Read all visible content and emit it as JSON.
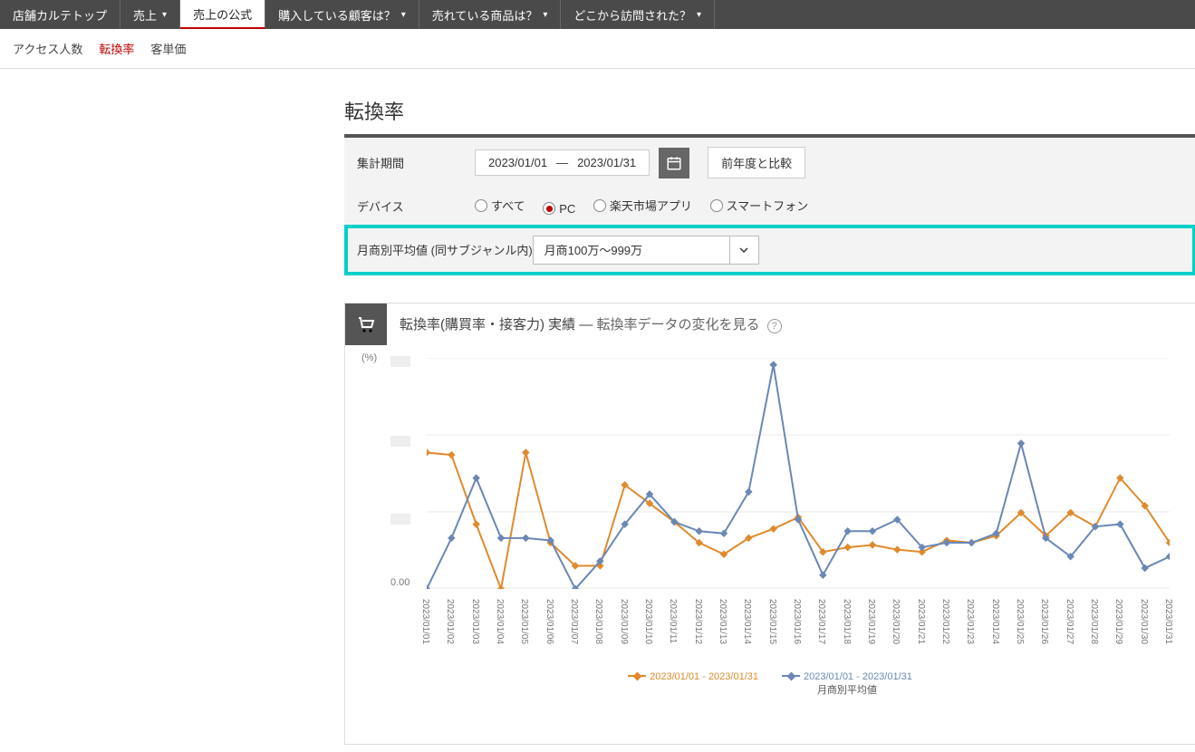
{
  "nav": {
    "tabs": [
      {
        "label": "店舗カルテトップ",
        "chev": false
      },
      {
        "label": "売上",
        "chev": true
      },
      {
        "label": "売上の公式",
        "chev": false,
        "active": true
      },
      {
        "label": "購入している顧客は？",
        "chev": true
      },
      {
        "label": "売れている商品は？",
        "chev": true
      },
      {
        "label": "どこから訪問された？",
        "chev": true
      }
    ],
    "sub": [
      {
        "label": "アクセス人数"
      },
      {
        "label": "転換率",
        "active": true
      },
      {
        "label": "客単価"
      }
    ]
  },
  "page_title": "転換率",
  "filter": {
    "period_label": "集計期間",
    "date_from": "2023/01/01",
    "date_sep": "―",
    "date_to": "2023/01/31",
    "compare_btn": "前年度と比較",
    "device_label": "デバイス",
    "devices": [
      {
        "label": "すべて"
      },
      {
        "label": "PC",
        "selected": true
      },
      {
        "label": "楽天市場アプリ"
      },
      {
        "label": "スマートフォン"
      }
    ],
    "avg_label": "月商別平均値",
    "avg_sub": "(同サブジャンル内)",
    "avg_select": "月商100万～999万"
  },
  "card": {
    "title": "転換率(購買率・接客力) 実績 ―",
    "link": "転換率データの変化を見る",
    "y_unit": "(%)",
    "zero": "0.00",
    "legend": {
      "orange": "2023/01/01 - 2023/01/31",
      "blue_line1": "2023/01/01 - 2023/01/31",
      "blue_line2": "月商別平均値"
    }
  },
  "chart_data": {
    "type": "line",
    "title": "転換率(購買率・接客力) 実績",
    "ylabel": "(%)",
    "ylim": [
      0,
      5.0
    ],
    "x": [
      "2023/01/01",
      "2023/01/02",
      "2023/01/03",
      "2023/01/04",
      "2023/01/05",
      "2023/01/06",
      "2023/01/07",
      "2023/01/08",
      "2023/01/09",
      "2023/01/10",
      "2023/01/11",
      "2023/01/12",
      "2023/01/13",
      "2023/01/14",
      "2023/01/15",
      "2023/01/16",
      "2023/01/17",
      "2023/01/18",
      "2023/01/19",
      "2023/01/20",
      "2023/01/21",
      "2023/01/22",
      "2023/01/23",
      "2023/01/24",
      "2023/01/25",
      "2023/01/26",
      "2023/01/27",
      "2023/01/28",
      "2023/01/29",
      "2023/01/30",
      "2023/01/31"
    ],
    "series": [
      {
        "name": "2023/01/01 - 2023/01/31",
        "color": "#e08a2c",
        "values": [
          2.95,
          2.9,
          1.4,
          0.0,
          2.95,
          1.0,
          0.5,
          0.5,
          2.25,
          1.85,
          1.45,
          1.0,
          0.75,
          1.1,
          1.3,
          1.55,
          0.8,
          0.9,
          0.95,
          0.85,
          0.8,
          1.05,
          1.0,
          1.15,
          1.65,
          1.15,
          1.65,
          1.35,
          2.4,
          1.8,
          1.0
        ]
      },
      {
        "name": "2023/01/01 - 2023/01/31 月商別平均値",
        "color": "#6a87b5",
        "values": [
          0.0,
          1.1,
          2.4,
          1.1,
          1.1,
          1.05,
          0.0,
          0.6,
          1.4,
          2.05,
          1.45,
          1.25,
          1.2,
          2.1,
          4.85,
          1.5,
          0.3,
          1.25,
          1.25,
          1.5,
          0.9,
          1.0,
          1.0,
          1.2,
          3.15,
          1.1,
          0.7,
          1.35,
          1.4,
          0.45,
          0.7
        ]
      }
    ]
  }
}
